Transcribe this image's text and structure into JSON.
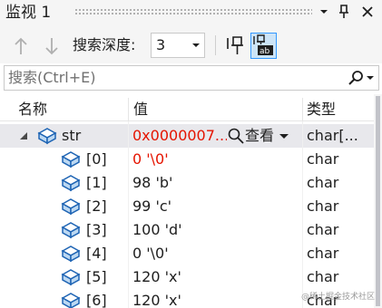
{
  "window": {
    "title": "监视 1",
    "dropdown_icon": "chevron-down-icon",
    "pin_icon": "pin-icon",
    "close_icon": "close-icon"
  },
  "toolbar": {
    "up_icon": "arrow-up-icon",
    "down_icon": "arrow-down-icon",
    "depth_label": "搜索深度:",
    "depth_value": "3",
    "pin_icon": "pin-icon",
    "hex_icon": "hex-display-icon"
  },
  "search": {
    "placeholder": "搜索(Ctrl+E)",
    "icon": "search-icon"
  },
  "columns": {
    "name": "名称",
    "value": "值",
    "type": "类型"
  },
  "root": {
    "name": "str",
    "value": "0x0000007...",
    "view_label": "查看",
    "type": "char[..."
  },
  "items": [
    {
      "name": "[0]",
      "value": "0 '\\0'",
      "type": "char"
    },
    {
      "name": "[1]",
      "value": "98 'b'",
      "type": "char"
    },
    {
      "name": "[2]",
      "value": "99 'c'",
      "type": "char"
    },
    {
      "name": "[3]",
      "value": "100 'd'",
      "type": "char"
    },
    {
      "name": "[4]",
      "value": "0 '\\0'",
      "type": "char"
    },
    {
      "name": "[5]",
      "value": "120 'x'",
      "type": "char"
    },
    {
      "name": "[6]",
      "value": "120 'x'",
      "type": "char"
    }
  ],
  "colors": {
    "changed_value": "#e51400",
    "selection": "#e8e8ec",
    "accent": "#3399ff"
  },
  "watermark": "@稀土掘金技术社区"
}
